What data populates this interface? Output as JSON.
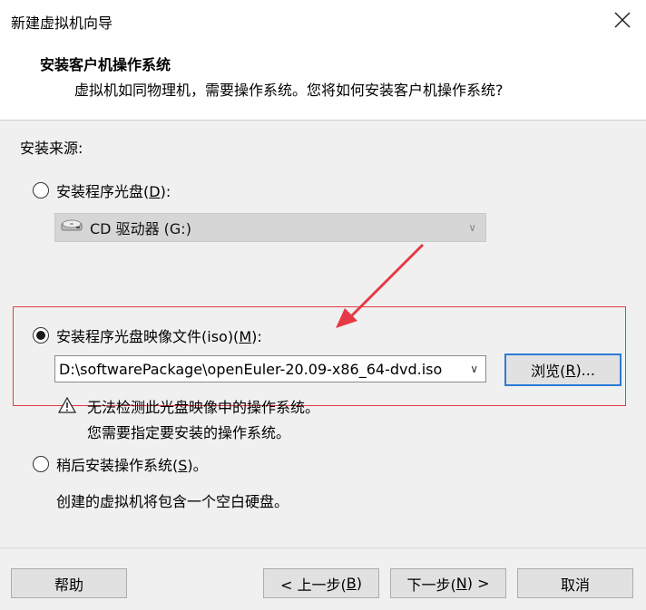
{
  "window": {
    "title": "新建虚拟机向导",
    "close_icon": "close-icon"
  },
  "header": {
    "heading": "安装客户机操作系统",
    "description": "虚拟机如同物理机，需要操作系统。您将如何安装客户机操作系统?"
  },
  "source": {
    "label": "安装来源:",
    "options": [
      {
        "label_prefix": "安装程序光盘(",
        "mnemonic": "D",
        "label_suffix": "):",
        "selected": false
      },
      {
        "label_prefix": "安装程序光盘映像文件(iso)(",
        "mnemonic": "M",
        "label_suffix": "):",
        "selected": true
      },
      {
        "label_prefix": "稍后安装操作系统(",
        "mnemonic": "S",
        "label_suffix": ")。",
        "selected": false
      }
    ],
    "cd_drive": {
      "value": "CD 驱动器 (G:)",
      "icon": "cd-drive-icon"
    },
    "iso_path": {
      "value": "D:\\softwarePackage\\openEuler-20.09-x86_64-dvd.iso"
    },
    "browse": {
      "label_prefix": "浏览(",
      "mnemonic": "R",
      "label_suffix": ")..."
    },
    "warning": {
      "icon": "warning-icon",
      "line1": "无法检测此光盘映像中的操作系统。",
      "line2": "您需要指定要安装的操作系统。"
    },
    "later_description": "创建的虚拟机将包含一个空白硬盘。"
  },
  "footer": {
    "help": "帮助",
    "back": {
      "prefix": "< 上一步(",
      "mnemonic": "B",
      "suffix": ")"
    },
    "next": {
      "prefix": "下一步(",
      "mnemonic": "N",
      "suffix": ") >"
    },
    "cancel": "取消"
  },
  "colors": {
    "annotation_red": "#e63946",
    "focus_blue": "#2b7bd6"
  }
}
